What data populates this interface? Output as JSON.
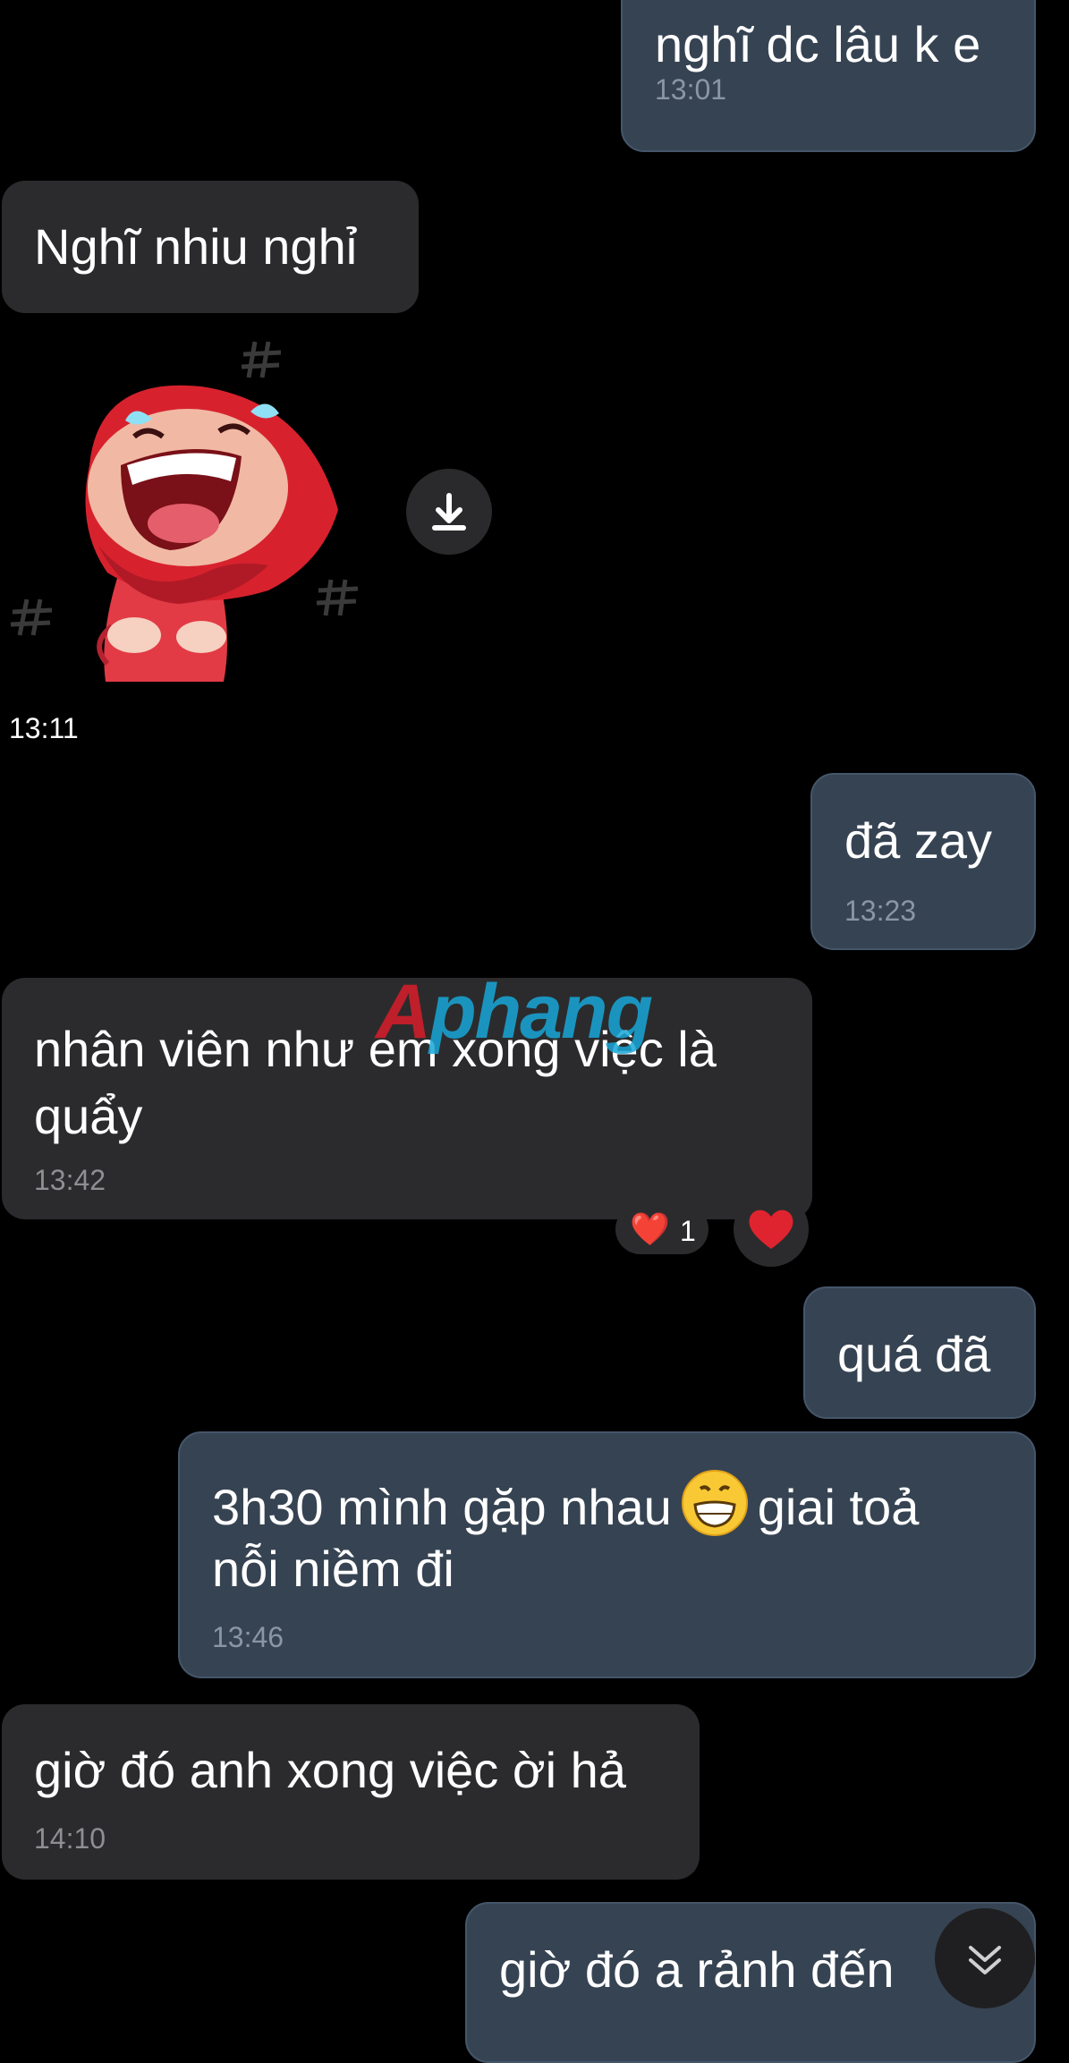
{
  "messages": {
    "m1": {
      "text": "nghĩ dc lâu k e",
      "time": "13:01"
    },
    "m2": {
      "text": "Nghĩ nhiu nghỉ"
    },
    "sticker": {
      "time": "13:11",
      "icon": "laughing-girl-sticker"
    },
    "m3": {
      "text": "đã zay",
      "time": "13:23"
    },
    "m4": {
      "line1": "nhân viên như em xong việc là",
      "line2": "quẩy",
      "time": "13:42"
    },
    "m4_reaction": {
      "emoji": "❤️",
      "count": "1"
    },
    "m5": {
      "text": "quá đã"
    },
    "m6": {
      "line1_a": "3h30 mình gặp nhau",
      "line1_b": "giai toả",
      "line2": "nỗi niềm đi",
      "time": "13:46",
      "emoji": "grinning-face-emoji"
    },
    "m7": {
      "text": "giờ đó anh xong việc ời hả",
      "time": "14:10"
    },
    "m8": {
      "text": "giờ đó a rảnh đến"
    }
  },
  "watermark": {
    "first": "A",
    "rest": "phang"
  },
  "controls": {
    "download_icon": "download-icon",
    "scroll_down_icon": "chevron-double-down-icon"
  },
  "colors": {
    "background": "#000000",
    "outgoing_bubble": "#364352",
    "incoming_bubble": "#2b2b2d",
    "time_text": "#8a96a5",
    "heart": "#e0242f"
  }
}
